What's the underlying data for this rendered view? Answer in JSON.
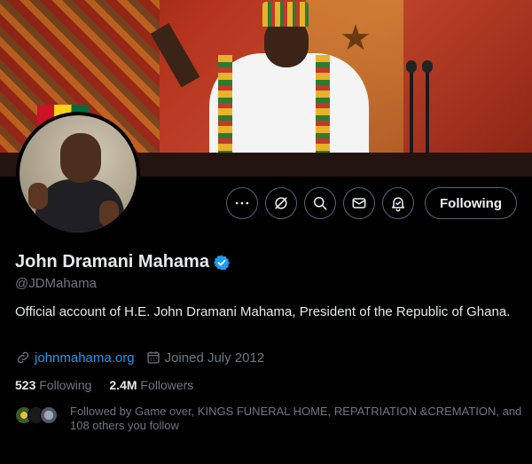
{
  "profile": {
    "name": "John Dramani Mahama",
    "handle": "@JDMahama",
    "bio": "Official account of H.E. John Dramani Mahama, President of the Republic of Ghana.",
    "website": "johnmahama.org",
    "joined": "Joined July 2012",
    "following_count": "523",
    "following_label": "Following",
    "followers_count": "2.4M",
    "followers_label": "Followers",
    "followed_by": "Followed by Game over, KINGS FUNERAL HOME, REPATRIATION &CREMATION, and 108 others you follow"
  },
  "actions": {
    "follow_label": "Following",
    "icons": [
      "more-icon",
      "grok-icon",
      "search-icon",
      "message-icon",
      "notifications-icon"
    ]
  },
  "colors": {
    "accent": "#1d9bf0",
    "verified": "#1d9bf0",
    "background": "#000000",
    "secondary_text": "#71767b"
  }
}
